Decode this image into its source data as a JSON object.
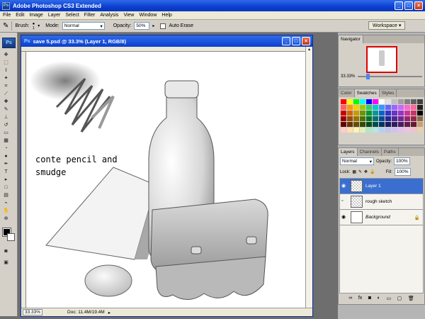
{
  "window": {
    "title": "Adobe Photoshop CS3 Extended",
    "min": "_",
    "max": "□",
    "close": "×"
  },
  "menu": [
    "File",
    "Edit",
    "Image",
    "Layer",
    "Select",
    "Filter",
    "Analysis",
    "View",
    "Window",
    "Help"
  ],
  "options": {
    "brush_label": "Brush:",
    "brush_size": "1",
    "mode_label": "Mode:",
    "mode_value": "Normal",
    "opacity_label": "Opacity:",
    "opacity_value": "50%",
    "auto_erase_label": "Auto Erase",
    "workspace_label": "Workspace ▾"
  },
  "toolbox": {
    "logo": "Ps"
  },
  "document": {
    "title": "save 5.psd @ 33.3% (Layer 1, RGB/8)",
    "canvas_text_line1": "conte pencil and",
    "canvas_text_line2": "smudge",
    "status_zoom": "33.33%",
    "status_doc": "Doc: 11.4M/19.4M"
  },
  "navigator": {
    "tabs": [
      "Navigator"
    ],
    "zoom": "33.33%"
  },
  "swatches": {
    "tabs": [
      "Color",
      "Swatches",
      "Styles"
    ],
    "colors": [
      "#ff0000",
      "#ffff00",
      "#00ff00",
      "#00ffff",
      "#0000ff",
      "#ff00ff",
      "#ffffff",
      "#e0e0e0",
      "#c0c0c0",
      "#a0a0a0",
      "#808080",
      "#606060",
      "#404040",
      "#ff6060",
      "#ff9900",
      "#ffcc00",
      "#99cc00",
      "#33cc66",
      "#00cccc",
      "#3399ff",
      "#6666ff",
      "#9966ff",
      "#cc66ff",
      "#ff66cc",
      "#ff6699",
      "#202020",
      "#cc0000",
      "#cc6600",
      "#cc9900",
      "#669900",
      "#009933",
      "#009999",
      "#0066cc",
      "#3333cc",
      "#6633cc",
      "#9933cc",
      "#cc3399",
      "#cc3366",
      "#000000",
      "#990000",
      "#994c00",
      "#997300",
      "#4d7300",
      "#007326",
      "#007373",
      "#004d99",
      "#262699",
      "#4d2699",
      "#732699",
      "#992673",
      "#99264d",
      "#8a6a4a",
      "#660000",
      "#663300",
      "#664d00",
      "#334d00",
      "#004d1a",
      "#004d4d",
      "#003366",
      "#1a1a66",
      "#331a66",
      "#4d1a66",
      "#661a4d",
      "#661a33",
      "#c8a070",
      "#ffcccc",
      "#ffe0b3",
      "#fff2b3",
      "#e0f0b3",
      "#b3e6c6",
      "#b3e6e6",
      "#b3d1f0",
      "#c2c2f0",
      "#d1c2f0",
      "#e0c2f0",
      "#f0c2e0",
      "#f0c2d1",
      "#e8d0b0"
    ]
  },
  "layers": {
    "tabs": [
      "Layers",
      "Channels",
      "Paths"
    ],
    "blend_mode": "Normal",
    "opacity_label": "Opacity:",
    "opacity_value": "100%",
    "lock_label": "Lock:",
    "fill_label": "Fill:",
    "fill_value": "100%",
    "items": [
      {
        "name": "Layer 1",
        "selected": true
      },
      {
        "name": "rough sketch",
        "selected": false
      },
      {
        "name": "Background",
        "selected": false
      }
    ]
  }
}
